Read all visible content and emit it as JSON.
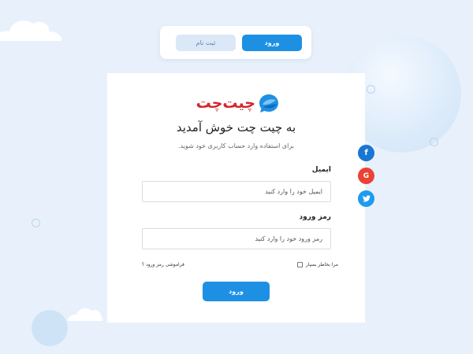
{
  "tabs": {
    "signup_label": "ثبت نام",
    "login_label": "ورود"
  },
  "brand": {
    "name": "چیت‌چت",
    "name_color": "#d4262e",
    "icon": "chat-bubble-icon"
  },
  "login": {
    "title": "به چیت چت خوش آمدید",
    "subtitle": "برای استفاده وارد حساب کاربری خود شوید.",
    "email_label": "ایمیل",
    "email_placeholder": "ایمیل خود را وارد کنید",
    "password_label": "رمز ورود",
    "password_placeholder": "رمز ورود خود را وارد کنید",
    "remember_label": "مرا بخاطر بسپار",
    "remember_checked": false,
    "forgot_label": "فراموشی رمز ورود ؟",
    "submit_label": "ورود"
  },
  "social": [
    {
      "name": "facebook",
      "icon": "facebook-icon",
      "glyph": "f",
      "color": "#1877d2"
    },
    {
      "name": "google",
      "icon": "google-icon",
      "glyph": "G",
      "color": "#ea4335"
    },
    {
      "name": "twitter",
      "icon": "twitter-icon",
      "glyph": "",
      "color": "#1d9bf0"
    }
  ],
  "colors": {
    "accent": "#1e90e4",
    "background": "#e8f1fb",
    "tab_inactive": "#dbe8f8"
  }
}
